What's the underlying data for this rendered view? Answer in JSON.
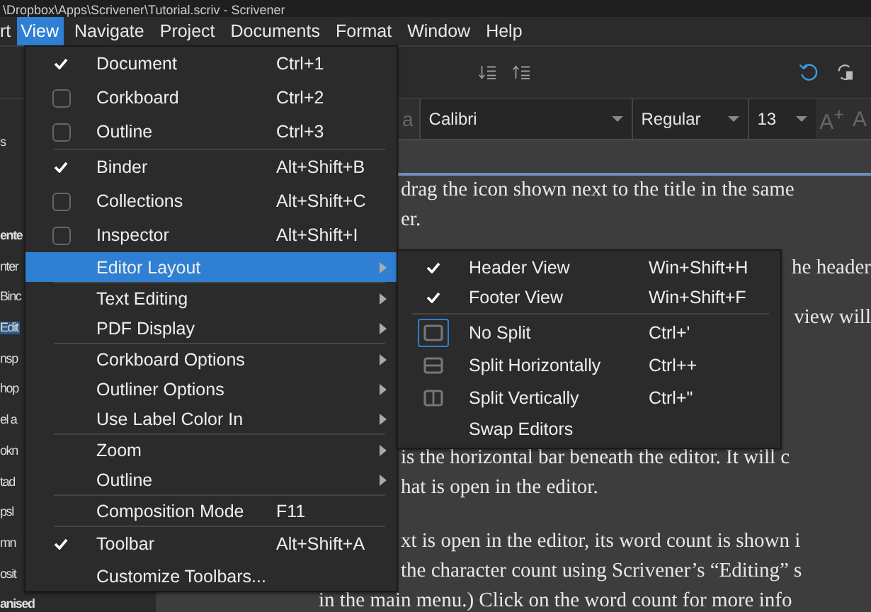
{
  "window": {
    "title": "\\Dropbox\\Apps\\Scrivener\\Tutorial.scriv - Scrivener"
  },
  "menubar": [
    {
      "label": "rt",
      "selected": false
    },
    {
      "label": "View",
      "selected": true
    },
    {
      "label": "Navigate",
      "selected": false
    },
    {
      "label": "Project",
      "selected": false
    },
    {
      "label": "Documents",
      "selected": false
    },
    {
      "label": "Format",
      "selected": false
    },
    {
      "label": "Window",
      "selected": false
    },
    {
      "label": "Help",
      "selected": false
    }
  ],
  "format_bar": {
    "style_fragment": "a",
    "font": "Calibri",
    "weight": "Regular",
    "size": "13",
    "grow_label": "A$^{+}$",
    "shrink_label": "A"
  },
  "binder": {
    "items": [
      {
        "label": "s",
        "kind": "item",
        "selected": false
      },
      {
        "label": "ente",
        "kind": "group",
        "selected": false
      },
      {
        "label": "nter",
        "kind": "item",
        "selected": false
      },
      {
        "label": "Binc",
        "kind": "item",
        "selected": false
      },
      {
        "label": "Edit",
        "kind": "item",
        "selected": true
      },
      {
        "label": "nsp",
        "kind": "item",
        "selected": false
      },
      {
        "label": "hop",
        "kind": "item",
        "selected": false
      },
      {
        "label": "el a",
        "kind": "item",
        "selected": false
      },
      {
        "label": "okn",
        "kind": "item",
        "selected": false
      },
      {
        "label": "tad",
        "kind": "item",
        "selected": false
      },
      {
        "label": "psl",
        "kind": "item",
        "selected": false
      },
      {
        "label": "mn",
        "kind": "item",
        "selected": false
      },
      {
        "label": "osit",
        "kind": "item",
        "selected": false
      },
      {
        "label": "anised",
        "kind": "group",
        "selected": false
      }
    ]
  },
  "editor": {
    "paragraphs": [
      [
        "drag the icon shown next to the title in the same",
        "er."
      ],
      [
        "he header",
        "view will"
      ],
      [
        "is the horizontal bar beneath the editor. It will c",
        "hat is open in the editor."
      ],
      [
        "xt is open in the editor, its word count is shown i",
        "the character count using Scrivener’s “Editing” s",
        "in the main menu.) Click on the word count for more info"
      ]
    ]
  },
  "view_menu": {
    "items": [
      {
        "kind": "check",
        "label": "Document",
        "shortcut": "Ctrl+1",
        "checked": true,
        "selected": false
      },
      {
        "kind": "check",
        "label": "Corkboard",
        "shortcut": "Ctrl+2",
        "checked": false,
        "selected": false
      },
      {
        "kind": "check",
        "label": "Outline",
        "shortcut": "Ctrl+3",
        "checked": false,
        "selected": false
      },
      {
        "kind": "separator"
      },
      {
        "kind": "check",
        "label": "Binder",
        "shortcut": "Alt+Shift+B",
        "checked": true,
        "selected": false
      },
      {
        "kind": "check",
        "label": "Collections",
        "shortcut": "Alt+Shift+C",
        "checked": false,
        "selected": false
      },
      {
        "kind": "check",
        "label": "Inspector",
        "shortcut": "Alt+Shift+I",
        "checked": false,
        "selected": false
      },
      {
        "kind": "submenu",
        "label": "Editor Layout",
        "selected": true
      },
      {
        "kind": "separator"
      },
      {
        "kind": "submenu",
        "label": "Text Editing",
        "selected": false
      },
      {
        "kind": "submenu",
        "label": "PDF Display",
        "selected": false
      },
      {
        "kind": "separator"
      },
      {
        "kind": "submenu",
        "label": "Corkboard Options",
        "selected": false
      },
      {
        "kind": "submenu",
        "label": "Outliner Options",
        "selected": false
      },
      {
        "kind": "submenu",
        "label": "Use Label Color In",
        "selected": false
      },
      {
        "kind": "separator"
      },
      {
        "kind": "submenu",
        "label": "Zoom",
        "selected": false
      },
      {
        "kind": "submenu",
        "label": "Outline",
        "selected": false
      },
      {
        "kind": "separator"
      },
      {
        "kind": "action",
        "label": "Composition Mode",
        "shortcut": "F11",
        "selected": false
      },
      {
        "kind": "separator"
      },
      {
        "kind": "check",
        "label": "Toolbar",
        "shortcut": "Alt+Shift+A",
        "checked": true,
        "selected": false
      },
      {
        "kind": "action",
        "label": "Customize Toolbars...",
        "selected": false
      }
    ]
  },
  "layout_submenu": {
    "items": [
      {
        "kind": "check",
        "label": "Header View",
        "shortcut": "Win+Shift+H",
        "checked": true,
        "selected": false
      },
      {
        "kind": "check",
        "label": "Footer View",
        "shortcut": "Win+Shift+F",
        "checked": true,
        "selected": false
      },
      {
        "kind": "separator"
      },
      {
        "kind": "single",
        "label": "No Split",
        "shortcut": "Ctrl+'",
        "active": true,
        "selected": false
      },
      {
        "kind": "hsplit",
        "label": "Split Horizontally",
        "shortcut": "Ctrl++",
        "active": false,
        "selected": false
      },
      {
        "kind": "vsplit",
        "label": "Split Vertically",
        "shortcut": "Ctrl+\"",
        "active": false,
        "selected": false
      },
      {
        "kind": "action",
        "label": "Swap Editors",
        "selected": false
      }
    ]
  }
}
